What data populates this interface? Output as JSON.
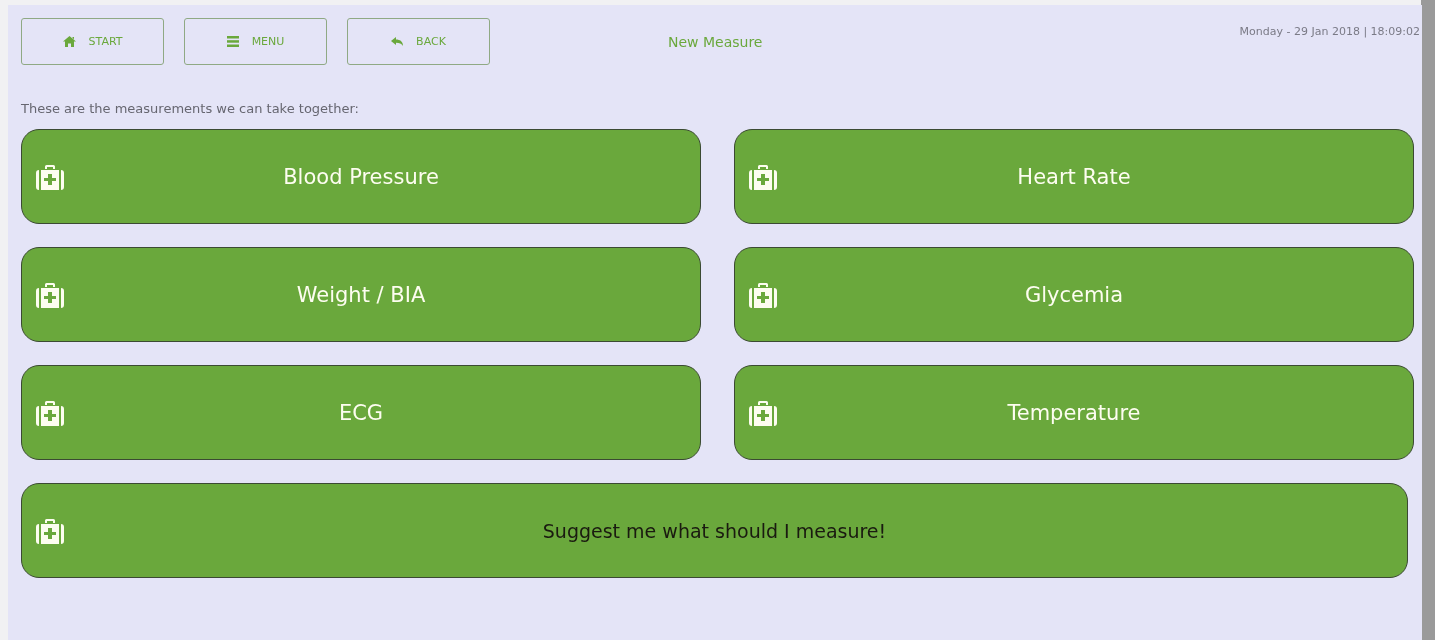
{
  "nav_buttons": [
    {
      "label": "START",
      "kind": "home"
    },
    {
      "label": "MENU",
      "kind": "menu"
    },
    {
      "label": "BACK",
      "kind": "back"
    }
  ],
  "title": "New Measure",
  "datetime": "Monday - 29 Jan 2018 | 18:09:02",
  "intro": "These are the measurements we can take together:",
  "options": [
    {
      "label": "Blood Pressure",
      "kind": "measure"
    },
    {
      "label": "Heart Rate",
      "kind": "measure"
    },
    {
      "label": "Weight / BIA",
      "kind": "measure"
    },
    {
      "label": "Glycemia",
      "kind": "measure"
    },
    {
      "label": "ECG",
      "kind": "measure"
    },
    {
      "label": "Temperature",
      "kind": "measure"
    },
    {
      "label": "Suggest me what should I measure!",
      "kind": "suggest"
    }
  ]
}
